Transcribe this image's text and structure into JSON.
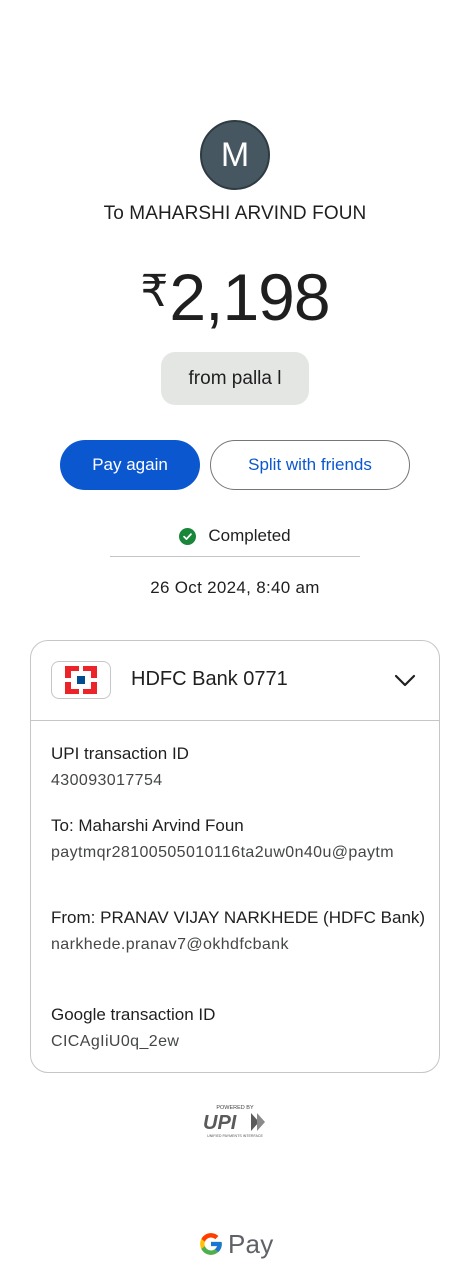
{
  "payee": {
    "avatar_letter": "M",
    "name_line": "To MAHARSHI ARVIND FOUN"
  },
  "payment": {
    "currency_symbol": "₹",
    "amount": "2,198",
    "note": "from palla l"
  },
  "actions": {
    "pay_again": "Pay again",
    "split": "Split with friends"
  },
  "status": {
    "text": "Completed",
    "color": "#198639",
    "datetime": "26 Oct 2024, 8:40 am"
  },
  "account": {
    "bank_name": "HDFC Bank 0771"
  },
  "details": [
    {
      "label": "UPI transaction ID",
      "value": "430093017754"
    },
    {
      "label": "To: Maharshi Arvind Foun",
      "value": "paytmqr28100505010116ta2uw0n40u@paytm"
    },
    {
      "label": "From: PRANAV VIJAY NARKHEDE (HDFC Bank)",
      "value": "narkhede.pranav7@okhdfcbank"
    },
    {
      "label": "Google transaction ID",
      "value": "CICAgIiU0q_2ew"
    }
  ],
  "footer": {
    "upi_powered": "POWERED BY",
    "upi_mark": "UPI",
    "upi_sub": "UNIFIED PAYMENTS INTERFACE",
    "gpay_label": "Pay"
  },
  "colors": {
    "primary": "#0b57d0",
    "avatar_bg": "#475761",
    "chip_bg": "#e4e6e4"
  }
}
